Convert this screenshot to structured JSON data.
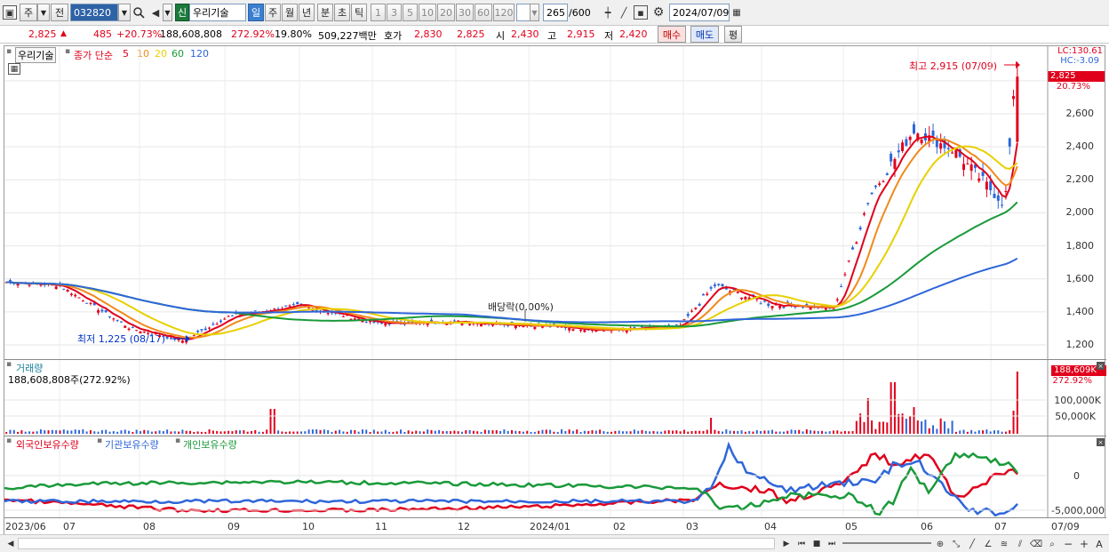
{
  "toolbar": {
    "market": "주",
    "prev_label": "전",
    "code": "032820",
    "new_badge": "신",
    "stock_name": "우리기술",
    "periods": [
      "일",
      "주",
      "월",
      "년",
      "분",
      "초",
      "틱"
    ],
    "active_period": "일",
    "intervals": [
      "1",
      "3",
      "5",
      "10",
      "20",
      "30",
      "60",
      "120"
    ],
    "count": "265",
    "count_total": "/600",
    "date": "2024/07/09"
  },
  "quote": {
    "price": "2,825",
    "change": "485",
    "change_pct": "+20.73%",
    "volume": "188,608,808",
    "volume_ratio": "272.92%",
    "turnover": "19.80%",
    "amount": "509,227백만",
    "ask_label": "호가",
    "ask1": "2,830",
    "ask2": "2,825",
    "open_label": "시",
    "open": "2,430",
    "high_label": "고",
    "high": "2,915",
    "low_label": "저",
    "low": "2,420",
    "buy_btn": "매수",
    "sell_btn": "매도",
    "eval_btn": "평"
  },
  "legend": {
    "name": "우리기술",
    "ma_title": "종가 단순",
    "ma_periods": [
      {
        "label": "5",
        "color": "#e0001b"
      },
      {
        "label": "10",
        "color": "#f08a1c"
      },
      {
        "label": "20",
        "color": "#e8d000"
      },
      {
        "label": "60",
        "color": "#1a9a3a"
      },
      {
        "label": "120",
        "color": "#2f66d9"
      }
    ]
  },
  "price_panel": {
    "y_ticks": [
      "2,600",
      "2,400",
      "2,200",
      "2,000",
      "1,800",
      "1,600",
      "1,400",
      "1,200"
    ],
    "lc": "LC:130.61",
    "hc": "HC:-3.09",
    "last_price_tag": "2,825",
    "last_pct_tag": "20.73%",
    "high_note": "최고 2,915 (07/09)",
    "low_note": "최저 1,225 (08/17)",
    "dividend_note": "배당락(0.00%)"
  },
  "volume_panel": {
    "title": "거래량",
    "subtitle": "188,608,808주(272.92%)",
    "tag": "188,609K",
    "tag_pct": "272.92%",
    "y_ticks": [
      "100,000K",
      "50,000K"
    ]
  },
  "holdings_panel": {
    "series": [
      {
        "label": "외국인보유수량",
        "color": "#e0001b"
      },
      {
        "label": "기관보유수량",
        "color": "#2f66d9"
      },
      {
        "label": "개인보유수량",
        "color": "#1a9a3a"
      }
    ],
    "y_ticks": [
      "0",
      "-5,000,000"
    ]
  },
  "x_axis": [
    "2023/06",
    "07",
    "08",
    "09",
    "10",
    "11",
    "12",
    "2024/01",
    "02",
    "03",
    "04",
    "05",
    "06",
    "07",
    "07/09"
  ],
  "chart_data": {
    "type": "candlestick",
    "title": "우리기술",
    "ylim": [
      1150,
      2950
    ],
    "x_range": [
      "2023/06",
      "2024/07/09"
    ],
    "close_path": [
      [
        "2023/06",
        1580
      ],
      [
        "07",
        1560
      ],
      [
        "08",
        1300
      ],
      [
        "08/17",
        1225
      ],
      [
        "09",
        1370
      ],
      [
        "10",
        1440
      ],
      [
        "11",
        1330
      ],
      [
        "12",
        1340
      ],
      [
        "2024/01",
        1320
      ],
      [
        "02",
        1290
      ],
      [
        "03",
        1310
      ],
      [
        "03(mid)",
        1560
      ],
      [
        "04",
        1450
      ],
      [
        "05",
        1420
      ],
      [
        "05(late)",
        2100
      ],
      [
        "06",
        2500
      ],
      [
        "06(mid)",
        2380
      ],
      [
        "07",
        2050
      ],
      [
        "07/09",
        2825
      ]
    ],
    "annotations": [
      "최고 2,915 (07/09)",
      "최저 1,225 (08/17)",
      "배당락(0.00%)"
    ]
  }
}
